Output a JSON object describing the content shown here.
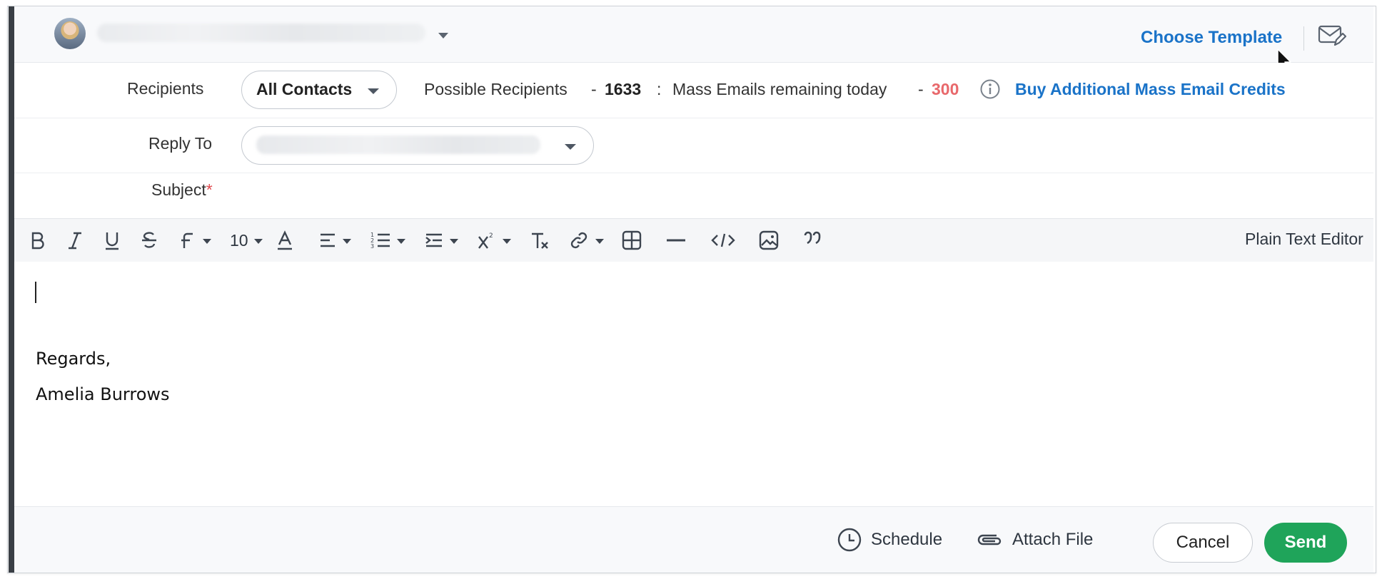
{
  "header": {
    "from_selector": "blurred sender address",
    "choose_template": "Choose Template"
  },
  "recipients": {
    "label": "Recipients",
    "selected": "All Contacts",
    "possible_label": "Possible Recipients",
    "possible_sep": "-",
    "possible_count": "1633",
    "colon": ":",
    "mass_label": "Mass Emails remaining today",
    "mass_sep": "-",
    "mass_remaining": "300",
    "buy_link": "Buy Additional Mass Email Credits"
  },
  "reply_to": {
    "label": "Reply To"
  },
  "subject": {
    "label": "Subject",
    "required_mark": "*"
  },
  "toolbar": {
    "font_size": "10",
    "plain_text_editor": "Plain Text Editor"
  },
  "editor": {
    "regards": "Regards,",
    "signature_name": "Amelia Burrows"
  },
  "footer": {
    "schedule": "Schedule",
    "attach_file": "Attach File",
    "cancel": "Cancel",
    "send": "Send"
  },
  "colors": {
    "link": "#1a73c8",
    "send": "#1fa45a",
    "remaining": "#e8686b"
  }
}
